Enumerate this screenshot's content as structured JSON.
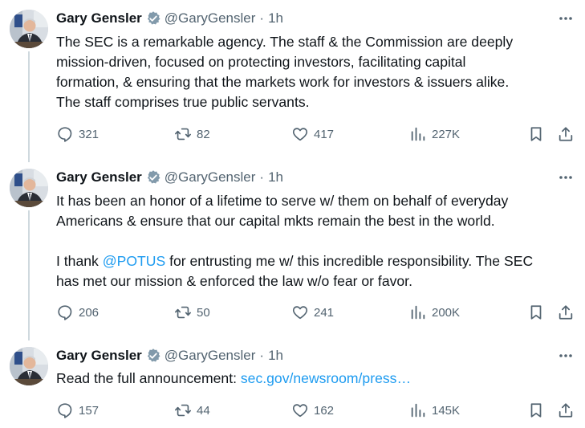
{
  "author": {
    "name": "Gary Gensler",
    "handle": "@GaryGensler",
    "separator": "·",
    "time": "1h"
  },
  "icons": {
    "verified": "verified-badge-icon",
    "more": "more-horizontal-icon",
    "reply": "reply-icon",
    "retweet": "retweet-icon",
    "like": "like-heart-icon",
    "views": "views-bar-chart-icon",
    "bookmark": "bookmark-icon",
    "share": "share-icon"
  },
  "colors": {
    "text": "#0f1419",
    "muted": "#536471",
    "link": "#1d9bf0",
    "thread_line": "#cfd9de"
  },
  "tweets": [
    {
      "lines": [
        "The SEC is a remarkable agency. The staff & the Commission are deeply",
        "mission-driven, focused on protecting investors, facilitating capital",
        "formation, & ensuring that the markets work for investors & issuers alike.",
        "The staff comprises true public servants."
      ],
      "stats": {
        "replies": "321",
        "retweets": "82",
        "likes": "417",
        "views": "227K"
      }
    },
    {
      "para1": [
        "It has been an honor of a lifetime to serve w/ them on behalf of everyday",
        "Americans & ensure that our capital mkts remain the best in the world."
      ],
      "para2_prefix": "I thank ",
      "mention": "@POTUS",
      "para2_suffix": " for entrusting me w/ this incredible responsibility. The SEC",
      "para2_line2": "has met our mission & enforced the law w/o fear or favor.",
      "stats": {
        "replies": "206",
        "retweets": "50",
        "likes": "241",
        "views": "200K"
      }
    },
    {
      "prefix": "Read the full announcement: ",
      "link": "sec.gov/newsroom/press…",
      "stats": {
        "replies": "157",
        "retweets": "44",
        "likes": "162",
        "views": "145K"
      }
    }
  ]
}
